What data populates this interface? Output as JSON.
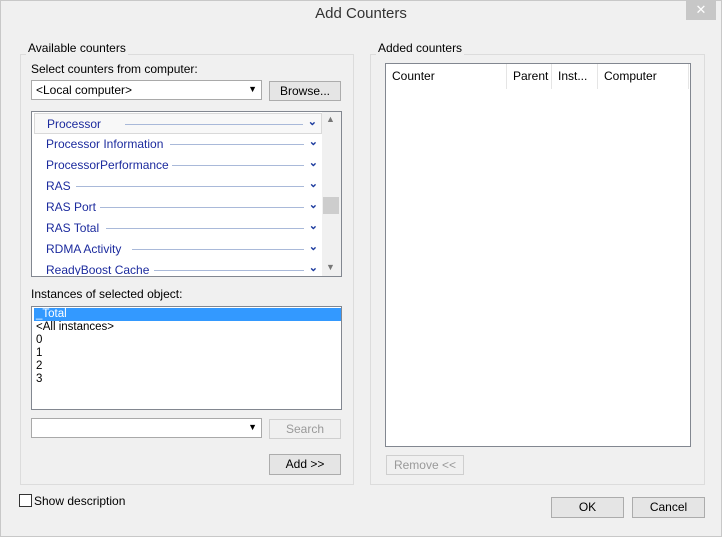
{
  "title": "Add Counters",
  "available": {
    "group_label": "Available counters",
    "computer_label": "Select counters from computer:",
    "computer_value": "<Local computer>",
    "browse_label": "Browse...",
    "counters": [
      "Processor",
      "Processor Information",
      "ProcessorPerformance",
      "RAS",
      "RAS Port",
      "RAS Total",
      "RDMA Activity",
      "ReadyBoost Cache"
    ],
    "selected_counter": "Processor",
    "instances_label": "Instances of selected object:",
    "instances": [
      "_Total",
      "<All instances>",
      "0",
      "1",
      "2",
      "3"
    ],
    "search_value": "",
    "search_label": "Search",
    "add_label": "Add >>"
  },
  "added": {
    "group_label": "Added counters",
    "columns": [
      "Counter",
      "Parent",
      "Inst...",
      "Computer"
    ],
    "remove_label": "Remove <<"
  },
  "footer": {
    "show_description": "Show description",
    "ok": "OK",
    "cancel": "Cancel"
  }
}
